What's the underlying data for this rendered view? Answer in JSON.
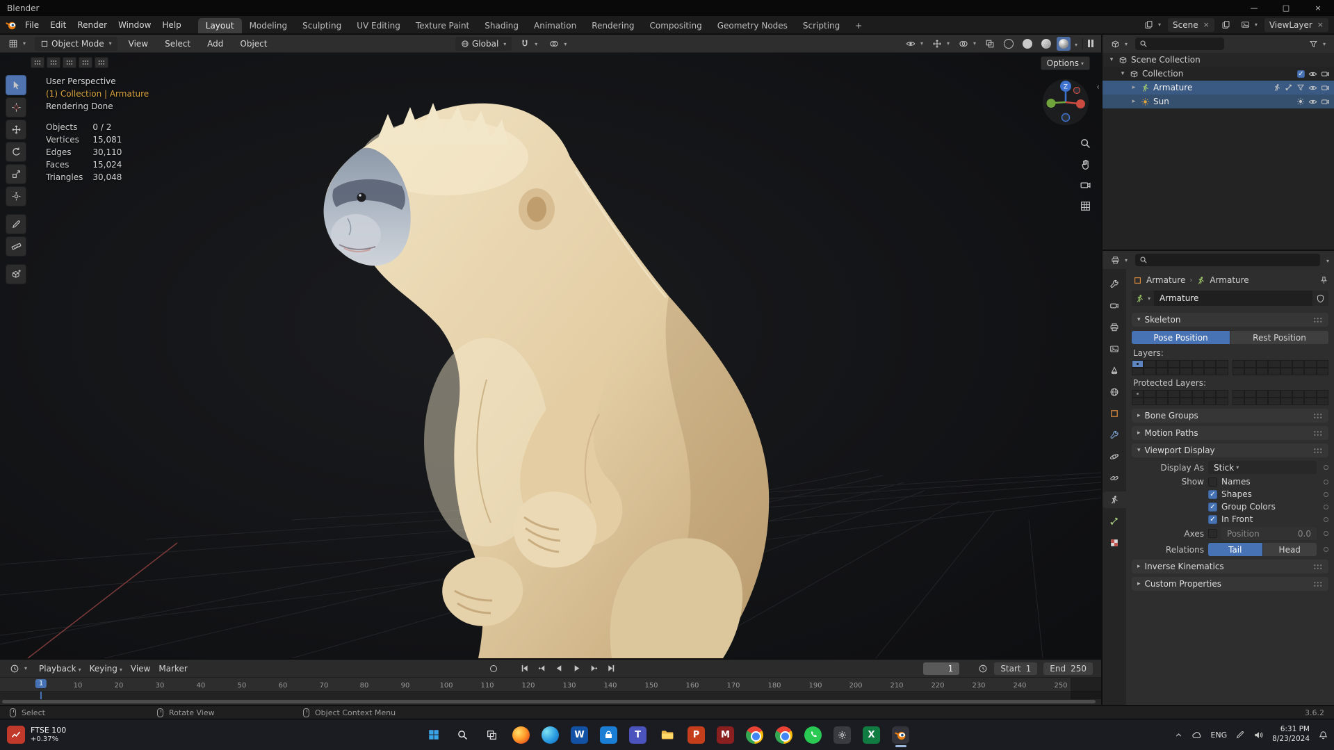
{
  "window": {
    "title": "Blender"
  },
  "topbar": {
    "menus": [
      "File",
      "Edit",
      "Render",
      "Window",
      "Help"
    ],
    "workspaces": [
      "Layout",
      "Modeling",
      "Sculpting",
      "UV Editing",
      "Texture Paint",
      "Shading",
      "Animation",
      "Rendering",
      "Compositing",
      "Geometry Nodes",
      "Scripting"
    ],
    "add_tab": "+",
    "scene": "Scene",
    "view_layer": "ViewLayer"
  },
  "viewport_header": {
    "mode": "Object Mode",
    "menus": [
      "View",
      "Select",
      "Add",
      "Object"
    ],
    "orientation": "Global",
    "options": "Options"
  },
  "viewport": {
    "perspective": "User Perspective",
    "context": "(1) Collection | Armature",
    "render_status": "Rendering Done",
    "gizmo_z": "Z",
    "stats": [
      {
        "label": "Objects",
        "value": "0 / 2"
      },
      {
        "label": "Vertices",
        "value": "15,081"
      },
      {
        "label": "Edges",
        "value": "30,110"
      },
      {
        "label": "Faces",
        "value": "15,024"
      },
      {
        "label": "Triangles",
        "value": "30,048"
      }
    ]
  },
  "outliner": {
    "rows": [
      {
        "label": "Scene Collection"
      },
      {
        "label": "Collection"
      },
      {
        "label": "Armature"
      },
      {
        "label": "Sun"
      }
    ]
  },
  "properties": {
    "breadcrumb_object": "Armature",
    "breadcrumb_data": "Armature",
    "name": "Armature",
    "skeleton_title": "Skeleton",
    "pose_position": "Pose Position",
    "rest_position": "Rest Position",
    "layers_label": "Layers:",
    "protected_layers_label": "Protected Layers:",
    "bone_groups": "Bone Groups",
    "motion_paths": "Motion Paths",
    "viewport_display_title": "Viewport Display",
    "display_as_label": "Display As",
    "display_as_value": "Stick",
    "show_label": "Show",
    "names": "Names",
    "shapes": "Shapes",
    "group_colors": "Group Colors",
    "in_front": "In Front",
    "axes_label": "Axes",
    "position_label": "Position",
    "position_value": "0.0",
    "relations_label": "Relations",
    "tail": "Tail",
    "head": "Head",
    "inverse_kinematics": "Inverse Kinematics",
    "custom_properties": "Custom Properties"
  },
  "timeline": {
    "menus": [
      "Playback",
      "Keying",
      "View",
      "Marker"
    ],
    "current_frame": "1",
    "start_label": "Start",
    "start_value": "1",
    "end_label": "End",
    "end_value": "250",
    "ticks": [
      "10",
      "20",
      "30",
      "40",
      "50",
      "60",
      "70",
      "80",
      "90",
      "100",
      "110",
      "120",
      "130",
      "140",
      "150",
      "160",
      "170",
      "180",
      "190",
      "200",
      "210",
      "220",
      "230",
      "240",
      "250"
    ]
  },
  "statusbar": {
    "items": [
      "Select",
      "Rotate View",
      "Object Context Menu"
    ],
    "version": "3.6.2"
  },
  "taskbar": {
    "stock_title": "FTSE 100",
    "stock_change": "+0.37%",
    "language": "ENG",
    "time": "6:31 PM",
    "date": "8/23/2024"
  },
  "icons": {
    "close": "×",
    "minimize": "—",
    "maximize": "□",
    "dropdown": "▾",
    "collapsed": "▸",
    "expanded": "▾",
    "check": "✓",
    "search": "magnifier",
    "filter": "funnel"
  },
  "colors": {
    "accent": "#4772b3",
    "selection": "#3a5a84",
    "blender_orange": "#e87d0d",
    "context_text": "#d9a440"
  }
}
